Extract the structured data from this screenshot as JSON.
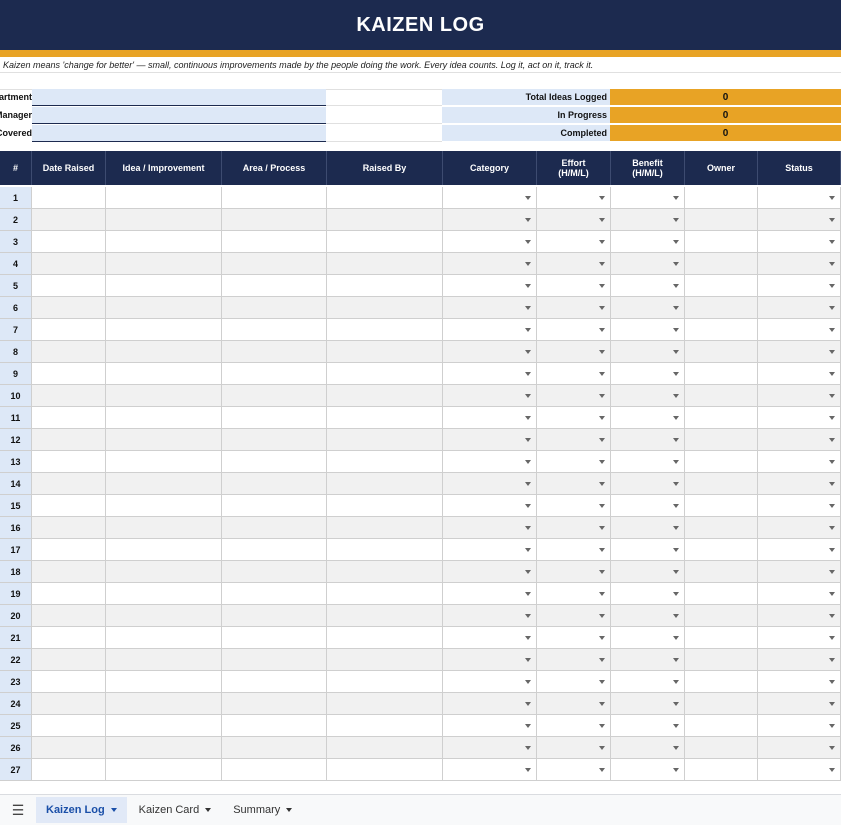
{
  "title": "KAIZEN LOG",
  "tagline": "Kaizen means 'change for better' — small, continuous improvements made by the people doing the work. Every idea counts. Log it, act on it, track it.",
  "info_labels": [
    "Department:",
    "Manager:",
    "Period Covered:"
  ],
  "kpis": [
    {
      "label": "Total Ideas Logged",
      "value": "0"
    },
    {
      "label": "In Progress",
      "value": "0"
    },
    {
      "label": "Completed",
      "value": "0"
    }
  ],
  "columns": [
    "#",
    "Date Raised",
    "Idea / Improvement",
    "Area / Process",
    "Raised By",
    "Category",
    "Effort\n(H/M/L)",
    "Benefit\n(H/M/L)",
    "Owner",
    "Status"
  ],
  "rows": [
    "1",
    "2",
    "3",
    "4",
    "5",
    "6",
    "7",
    "8",
    "9",
    "10",
    "11",
    "12",
    "13",
    "14",
    "15",
    "16",
    "17",
    "18",
    "19",
    "20",
    "21",
    "22",
    "23",
    "24",
    "25",
    "26",
    "27"
  ],
  "tabs": [
    {
      "label": "Kaizen Log",
      "active": true
    },
    {
      "label": "Kaizen Card",
      "active": false
    },
    {
      "label": "Summary",
      "active": false
    }
  ],
  "colors": {
    "header_navy": "#1c2a4f",
    "accent_orange": "#e8a325",
    "input_blue": "#dde8f7"
  },
  "icons": {
    "menu": "all-sheets-icon",
    "dropdown": "chevron-down-icon"
  }
}
